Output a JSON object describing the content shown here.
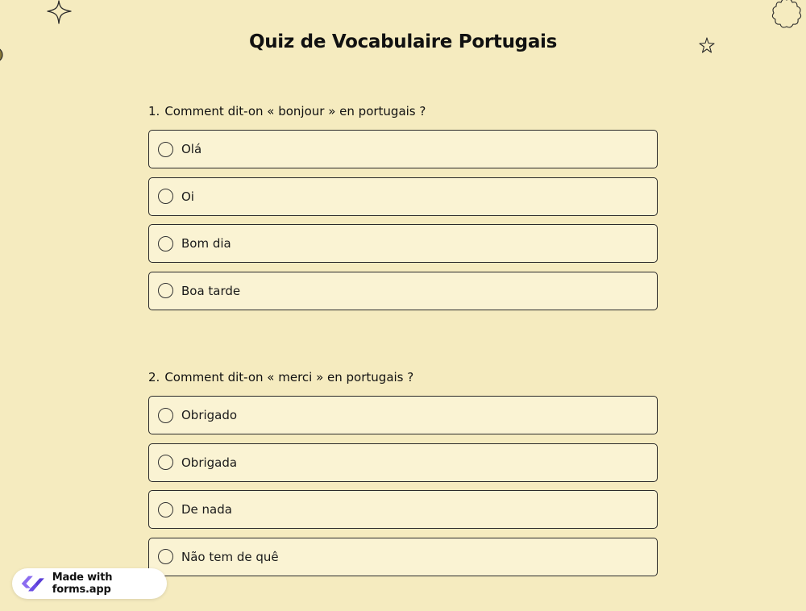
{
  "page": {
    "title": "Quiz de Vocabulaire Portugais"
  },
  "questions": [
    {
      "number": "1.",
      "text": "Comment dit-on « bonjour » en portugais ?",
      "options": [
        "Olá",
        "Oi",
        "Bom dia",
        "Boa tarde"
      ]
    },
    {
      "number": "2.",
      "text": "Comment dit-on « merci » en portugais ?",
      "options": [
        "Obrigado",
        "Obrigada",
        "De nada",
        "Não tem de quê"
      ]
    }
  ],
  "badge": {
    "label": "Made with forms.app",
    "icon": "forms-app-logo-icon"
  },
  "decorations": [
    "sparkle-icon",
    "star-icon",
    "flower-icon",
    "circle-icon"
  ],
  "colors": {
    "background": "#f5ebbf",
    "option_background": "#faf3d3",
    "border": "#2a2a2a",
    "text": "#111111",
    "logo_purple": "#6b4de6"
  }
}
